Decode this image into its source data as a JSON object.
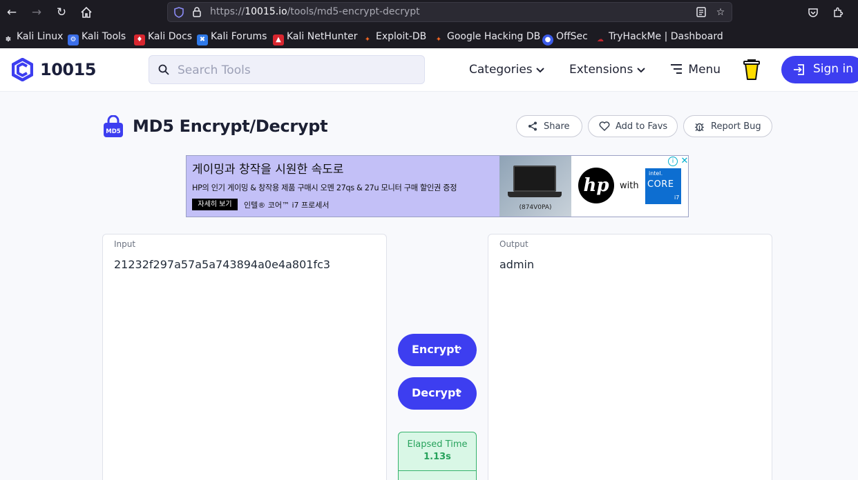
{
  "browser": {
    "url_prefix": "https://",
    "url_domain": "10015.io",
    "url_path": "/tools/md5-encrypt-decrypt",
    "bookmarks": [
      {
        "label": "Kali Linux"
      },
      {
        "label": "Kali Tools"
      },
      {
        "label": "Kali Docs"
      },
      {
        "label": "Kali Forums"
      },
      {
        "label": "Kali NetHunter"
      },
      {
        "label": "Exploit-DB"
      },
      {
        "label": "Google Hacking DB"
      },
      {
        "label": "OffSec"
      },
      {
        "label": "TryHackMe | Dashboard"
      }
    ]
  },
  "header": {
    "logo": "10015",
    "search_placeholder": "Search Tools",
    "categories": "Categories",
    "extensions": "Extensions",
    "menu": "Menu",
    "sign_in": "Sign in"
  },
  "tool": {
    "icon_label": "MD5",
    "title": "MD5 Encrypt/Decrypt",
    "share": "Share",
    "add_to_favs": "Add to Favs",
    "report_bug": "Report Bug"
  },
  "ad": {
    "headline": "게이밍과 창작을 시원한 속도로",
    "body": "HP의 인기 게이밍 & 창작용 제품 구매시 오멘 27qs & 27u 모니터 구매 할인권 증정",
    "cta": "자세히 보기",
    "sub": "인텔® 코어™ i7 프로세서",
    "model": "(874V0PA)",
    "brand_with": "with",
    "intel": "intel.",
    "core": "CORE",
    "i7": "i7"
  },
  "input": {
    "label": "Input",
    "value": "21232f297a57a5a743894a0e4a801fc3"
  },
  "output": {
    "label": "Output",
    "value": "admin"
  },
  "actions": {
    "encrypt": "Encrypt",
    "decrypt": "Decrypt",
    "elapsed_label": "Elapsed Time",
    "elapsed_value": "1.13s"
  }
}
